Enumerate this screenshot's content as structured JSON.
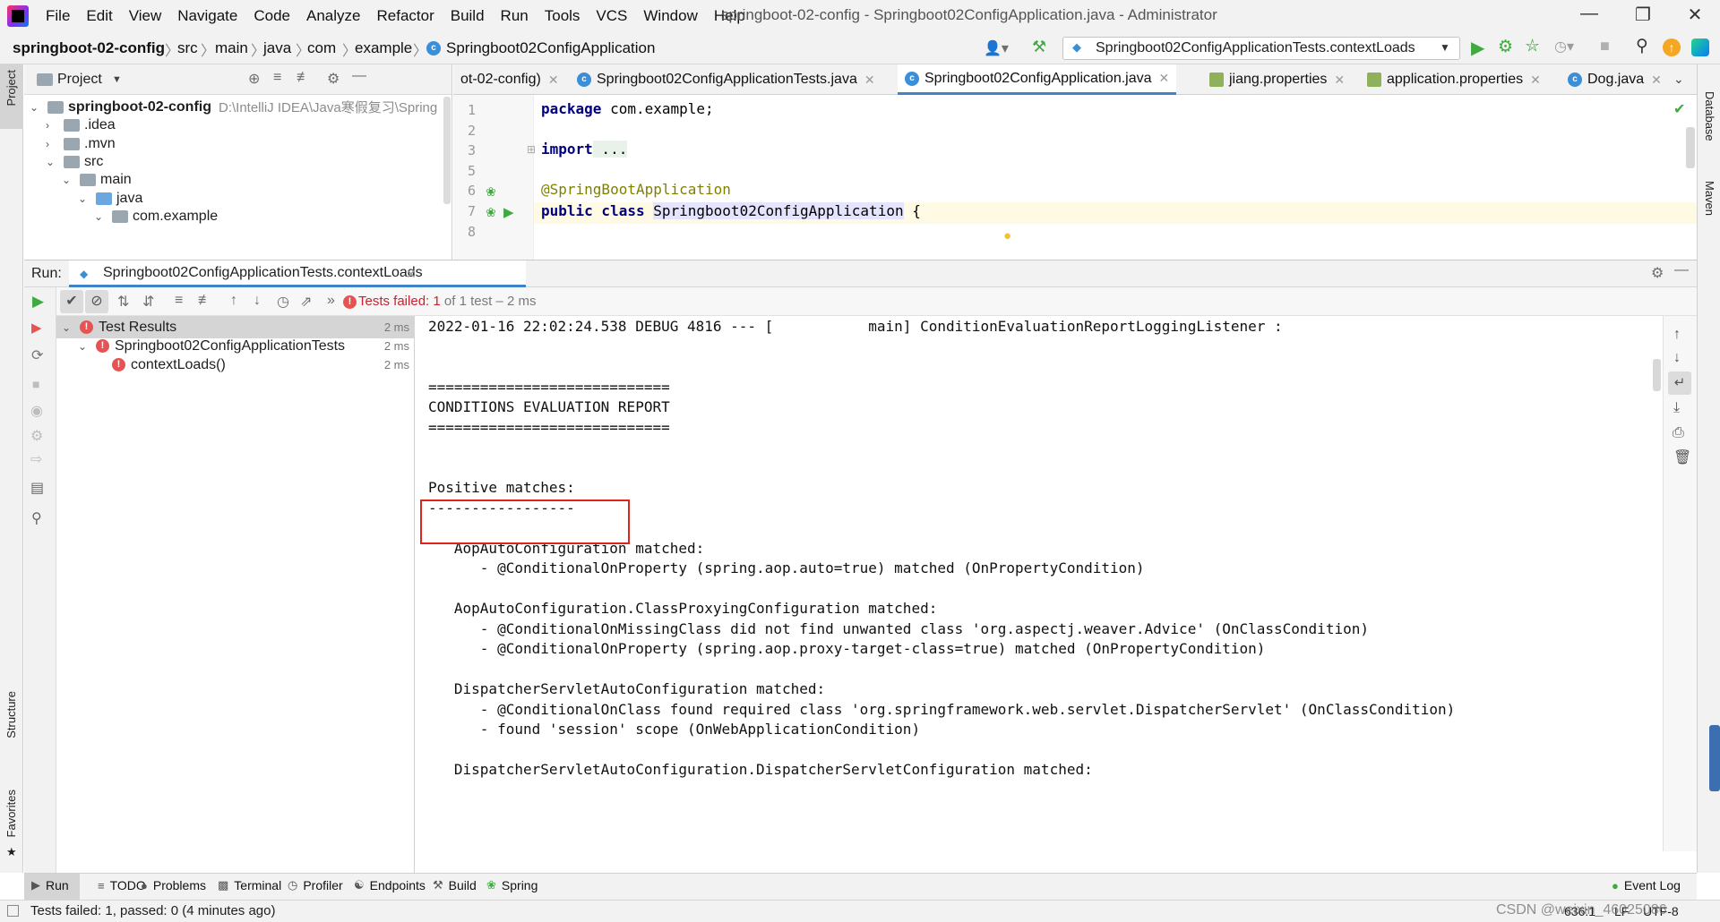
{
  "menubar": {
    "items": [
      "File",
      "Edit",
      "View",
      "Navigate",
      "Code",
      "Analyze",
      "Refactor",
      "Build",
      "Run",
      "Tools",
      "VCS",
      "Window",
      "Help"
    ],
    "window_title": "springboot-02-config - Springboot02ConfigApplication.java - Administrator"
  },
  "navbar": {
    "crumbs": [
      "springboot-02-config",
      "src",
      "main",
      "java",
      "com",
      "example",
      "Springboot02ConfigApplication"
    ],
    "run_config": "Springboot02ConfigApplicationTests.contextLoads"
  },
  "project": {
    "title": "Project",
    "tree": [
      {
        "label": "springboot-02-config",
        "extra": "D:\\IntelliJ IDEA\\Java寒假复习\\Spring"
      },
      {
        "label": ".idea"
      },
      {
        "label": ".mvn"
      },
      {
        "label": "src"
      },
      {
        "label": "main"
      },
      {
        "label": "java"
      },
      {
        "label": "com.example"
      }
    ]
  },
  "editor": {
    "tabs": [
      "ot-02-config)",
      "Springboot02ConfigApplicationTests.java",
      "Springboot02ConfigApplication.java",
      "jiang.properties",
      "application.properties",
      "Dog.java"
    ],
    "line_numbers": [
      "1",
      "2",
      "3",
      "5",
      "6",
      "7",
      "8"
    ],
    "code": {
      "package_kw": "package",
      "package_rest": " com.example;",
      "import_kw": "import",
      "import_rest": " ...",
      "annotation": "@SpringBootApplication",
      "public_kw": "public class",
      "class_name": "Springboot02ConfigApplication",
      "brace": " {"
    }
  },
  "run": {
    "label": "Run:",
    "tab": "Springboot02ConfigApplicationTests.contextLoads",
    "status_failed": "Tests failed:",
    "status_count": "1",
    "status_rest": "of 1 test – 2 ms",
    "tests": [
      {
        "label": "Test Results",
        "time": "2 ms"
      },
      {
        "label": "Springboot02ConfigApplicationTests",
        "time": "2 ms"
      },
      {
        "label": "contextLoads()",
        "time": "2 ms"
      }
    ],
    "console": [
      "2022-01-16 22:02:24.538 DEBUG 4816 --- [           main] ConditionEvaluationReportLoggingListener :",
      "",
      "",
      "============================",
      "CONDITIONS EVALUATION REPORT",
      "============================",
      "",
      "",
      "Positive matches:",
      "-----------------",
      "",
      "   AopAutoConfiguration matched:",
      "      - @ConditionalOnProperty (spring.aop.auto=true) matched (OnPropertyCondition)",
      "",
      "   AopAutoConfiguration.ClassProxyingConfiguration matched:",
      "      - @ConditionalOnMissingClass did not find unwanted class 'org.aspectj.weaver.Advice' (OnClassCondition)",
      "      - @ConditionalOnProperty (spring.aop.proxy-target-class=true) matched (OnPropertyCondition)",
      "",
      "   DispatcherServletAutoConfiguration matched:",
      "      - @ConditionalOnClass found required class 'org.springframework.web.servlet.DispatcherServlet' (OnClassCondition)",
      "      - found 'session' scope (OnWebApplicationCondition)",
      "",
      "   DispatcherServletAutoConfiguration.DispatcherServletConfiguration matched:"
    ]
  },
  "bottom_tabs": [
    "Run",
    "TODO",
    "Problems",
    "Terminal",
    "Profiler",
    "Endpoints",
    "Build",
    "Spring"
  ],
  "event_log": "Event Log",
  "status": {
    "message": "Tests failed: 1, passed: 0 (4 minutes ago)",
    "position": "636:1",
    "line_sep": "LF",
    "encoding": "UTF-8",
    "watermark": "CSDN @weixin_46025086"
  },
  "side_labels": {
    "project": "Project",
    "structure": "Structure",
    "favorites": "Favorites",
    "database": "Database",
    "maven": "Maven"
  },
  "colors": {
    "accent": "#4083c9",
    "error": "#e55353",
    "highlight_box": "#e0241c",
    "run_green": "#3faa3f"
  }
}
